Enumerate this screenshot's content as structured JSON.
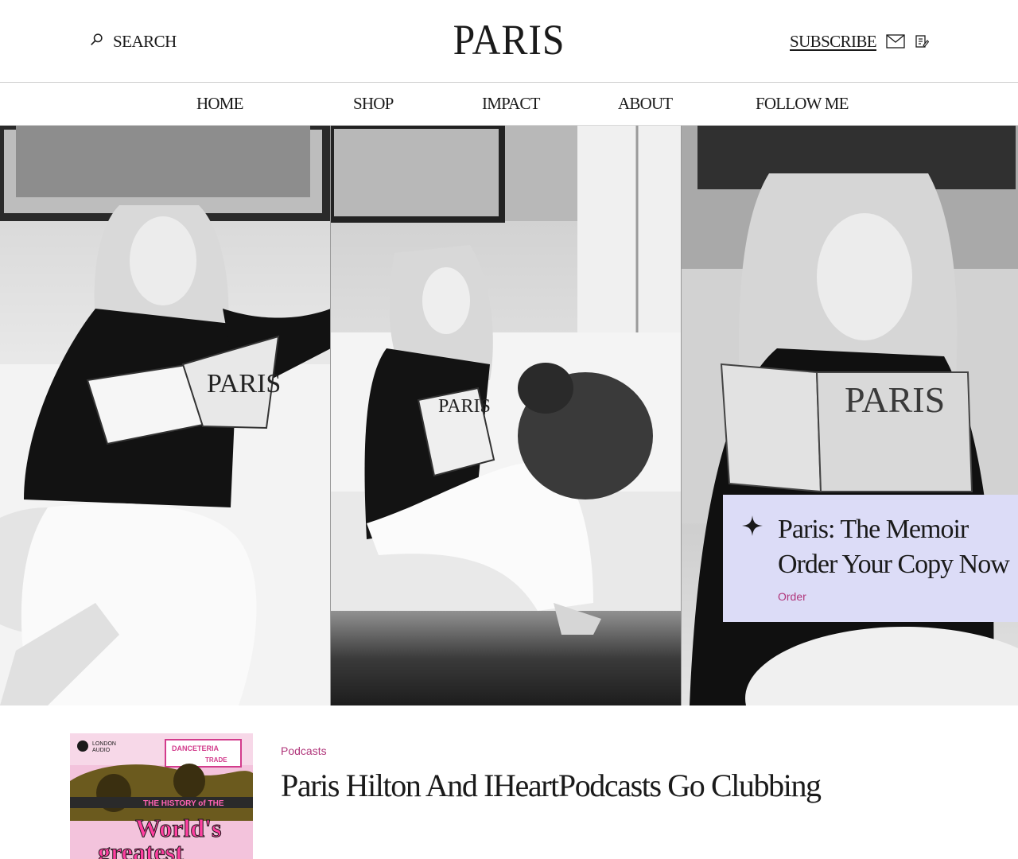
{
  "header": {
    "search_label": "SEARCH",
    "logo_text": "PARIS",
    "subscribe_label": "SUBSCRIBE"
  },
  "nav": {
    "items": [
      {
        "label": "HOME"
      },
      {
        "label": "SHOP"
      },
      {
        "label": "IMPACT"
      },
      {
        "label": "ABOUT"
      },
      {
        "label": "FOLLOW ME"
      }
    ]
  },
  "promo": {
    "title_line1": "Paris: The Memoir",
    "title_line2": "Order Your Copy Now",
    "link_label": "Order"
  },
  "article": {
    "category": "Podcasts",
    "title": "Paris Hilton And IHeartPodcasts Go Clubbing",
    "thumb_text": [
      "THE HISTORY of THE",
      "World's",
      "greatest"
    ],
    "thumb_brand": [
      "LONDON",
      "AUDIO"
    ],
    "thumb_sign": [
      "DANCETERIA",
      "TRADE"
    ]
  },
  "colors": {
    "accent": "#b0357a",
    "promo_bg": "#dcdcf7",
    "thumb_pink": "#f1b8d6"
  },
  "icons": {
    "search": "search-icon",
    "mail": "mail-icon",
    "edit": "edit-icon",
    "sparkle": "sparkle-icon"
  }
}
